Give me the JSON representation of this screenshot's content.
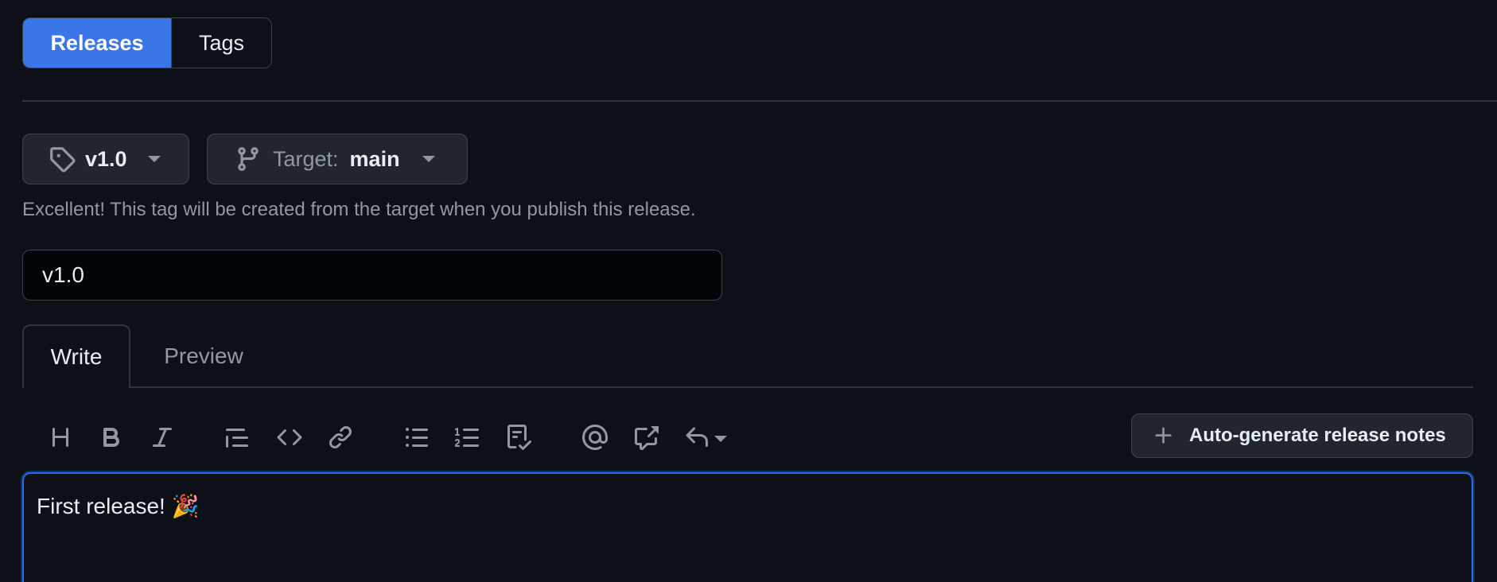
{
  "tabs_top": {
    "releases": "Releases",
    "tags": "Tags"
  },
  "tag_button": {
    "value": "v1.0",
    "icon": "tag-icon"
  },
  "target_button": {
    "label": "Target:",
    "value": "main",
    "icon": "git-branch-icon"
  },
  "hint": "Excellent! This tag will be created from the target when you publish this release.",
  "title_input": {
    "value": "v1.0"
  },
  "editor_tabs": {
    "write": "Write",
    "preview": "Preview"
  },
  "toolbar": {
    "icons": [
      "heading-icon",
      "bold-icon",
      "italic-icon",
      "quote-icon",
      "code-icon",
      "link-icon",
      "unordered-list-icon",
      "ordered-list-icon",
      "task-list-icon",
      "mention-icon",
      "cross-reference-icon",
      "reply-icon"
    ],
    "auto_generate_label": "Auto-generate release notes"
  },
  "editor": {
    "body": "First release! 🎉"
  },
  "colors": {
    "accent": "#3b76e8",
    "background": "#0d1117",
    "focus_border": "#1f6feb"
  }
}
